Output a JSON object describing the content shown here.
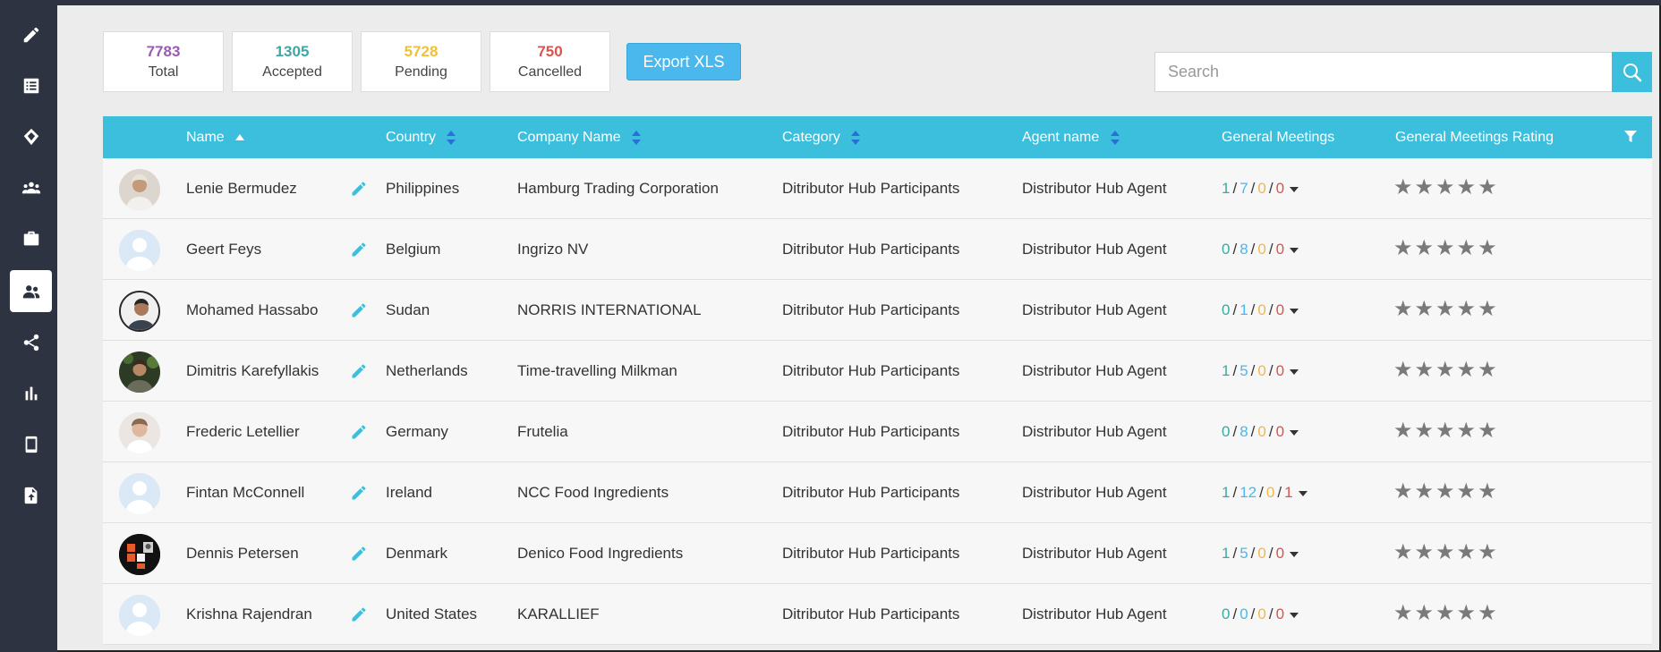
{
  "sidebar": {
    "items": [
      {
        "icon": "pencil-icon"
      },
      {
        "icon": "list-icon"
      },
      {
        "icon": "tag-icon"
      },
      {
        "icon": "group-icon"
      },
      {
        "icon": "briefcase-icon"
      },
      {
        "icon": "people-icon",
        "active": true
      },
      {
        "icon": "share-icon"
      },
      {
        "icon": "bar-chart-icon"
      },
      {
        "icon": "mobile-icon"
      },
      {
        "icon": "file-upload-icon"
      }
    ]
  },
  "stats": [
    {
      "value": "7783",
      "label": "Total",
      "color": "#9b59b6"
    },
    {
      "value": "1305",
      "label": "Accepted",
      "color": "#3aa9a3"
    },
    {
      "value": "5728",
      "label": "Pending",
      "color": "#f0c03a"
    },
    {
      "value": "750",
      "label": "Cancelled",
      "color": "#d9534f"
    }
  ],
  "toolbar": {
    "export_label": "Export XLS"
  },
  "search": {
    "placeholder": "Search",
    "value": ""
  },
  "table": {
    "columns": {
      "name": "Name",
      "country": "Country",
      "company": "Company Name",
      "category": "Category",
      "agent": "Agent name",
      "meetings": "General Meetings",
      "rating": "General Meetings Rating"
    },
    "rows": [
      {
        "name": "Lenie Bermudez",
        "country": "Philippines",
        "company": "Hamburg Trading Corporation",
        "category": "Ditributor Hub Participants",
        "agent": "Distributor Hub Agent",
        "m": [
          "1",
          "7",
          "0",
          "0"
        ],
        "rating": "★★★★★"
      },
      {
        "name": "Geert Feys",
        "country": "Belgium",
        "company": "Ingrizo NV",
        "category": "Ditributor Hub Participants",
        "agent": "Distributor Hub Agent",
        "m": [
          "0",
          "8",
          "0",
          "0"
        ],
        "rating": "★★★★★"
      },
      {
        "name": "Mohamed Hassabo",
        "country": "Sudan",
        "company": "NORRIS INTERNATIONAL",
        "category": "Ditributor Hub Participants",
        "agent": "Distributor Hub Agent",
        "m": [
          "0",
          "1",
          "0",
          "0"
        ],
        "rating": "★★★★★"
      },
      {
        "name": "Dimitris Karefyllakis",
        "country": "Netherlands",
        "company": "Time-travelling Milkman",
        "category": "Ditributor Hub Participants",
        "agent": "Distributor Hub Agent",
        "m": [
          "1",
          "5",
          "0",
          "0"
        ],
        "rating": "★★★★★"
      },
      {
        "name": "Frederic Letellier",
        "country": "Germany",
        "company": "Frutelia",
        "category": "Ditributor Hub Participants",
        "agent": "Distributor Hub Agent",
        "m": [
          "0",
          "8",
          "0",
          "0"
        ],
        "rating": "★★★★★"
      },
      {
        "name": "Fintan McConnell",
        "country": "Ireland",
        "company": "NCC Food Ingredients",
        "category": "Ditributor Hub Participants",
        "agent": "Distributor Hub Agent",
        "m": [
          "1",
          "12",
          "0",
          "1"
        ],
        "rating": "★★★★★"
      },
      {
        "name": "Dennis Petersen",
        "country": "Denmark",
        "company": "Denico Food Ingredients",
        "category": "Ditributor Hub Participants",
        "agent": "Distributor Hub Agent",
        "m": [
          "1",
          "5",
          "0",
          "0"
        ],
        "rating": "★★★★★"
      },
      {
        "name": "Krishna Rajendran",
        "country": "United States",
        "company": "KARALLIEF",
        "category": "Ditributor Hub Participants",
        "agent": "Distributor Hub Agent",
        "m": [
          "0",
          "0",
          "0",
          "0"
        ],
        "rating": "★★★★★"
      }
    ]
  }
}
